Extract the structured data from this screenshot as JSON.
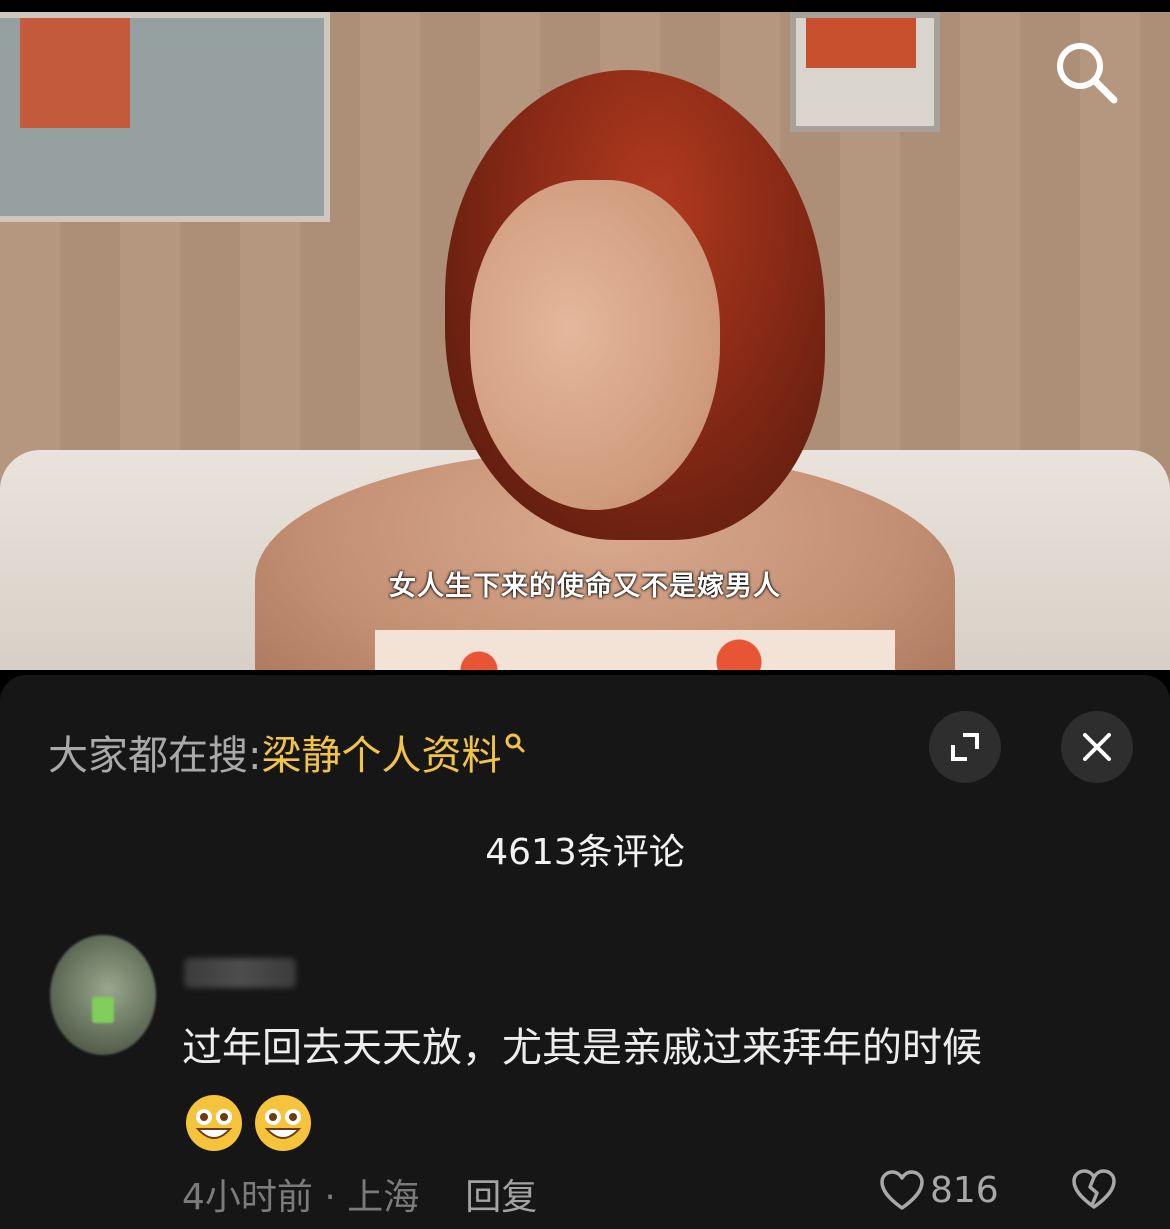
{
  "video": {
    "subtitle": "女人生下来的使命又不是嫁男人",
    "search_icon": "search-icon"
  },
  "suggestion": {
    "prefix": "大家都在搜:",
    "keyword": "梁静个人资料",
    "icon": "search-small-icon"
  },
  "panel_controls": {
    "expand_icon": "expand-icon",
    "close_icon": "close-icon"
  },
  "comments_header": {
    "count_label": "4613条评论"
  },
  "comment": {
    "text": "过年回去天天放，尤其是亲戚过来拜年的时候",
    "emojis": [
      "grinning-emoji",
      "grinning-emoji"
    ],
    "time_location": "4小时前 · 上海",
    "reply_label": "回复",
    "like_count": "816",
    "like_icon": "heart-outline-icon",
    "dislike_icon": "broken-heart-icon"
  },
  "colors": {
    "keyword": "#f3c343",
    "panel_bg": "#161616",
    "button_bg": "#2e2e2e"
  }
}
